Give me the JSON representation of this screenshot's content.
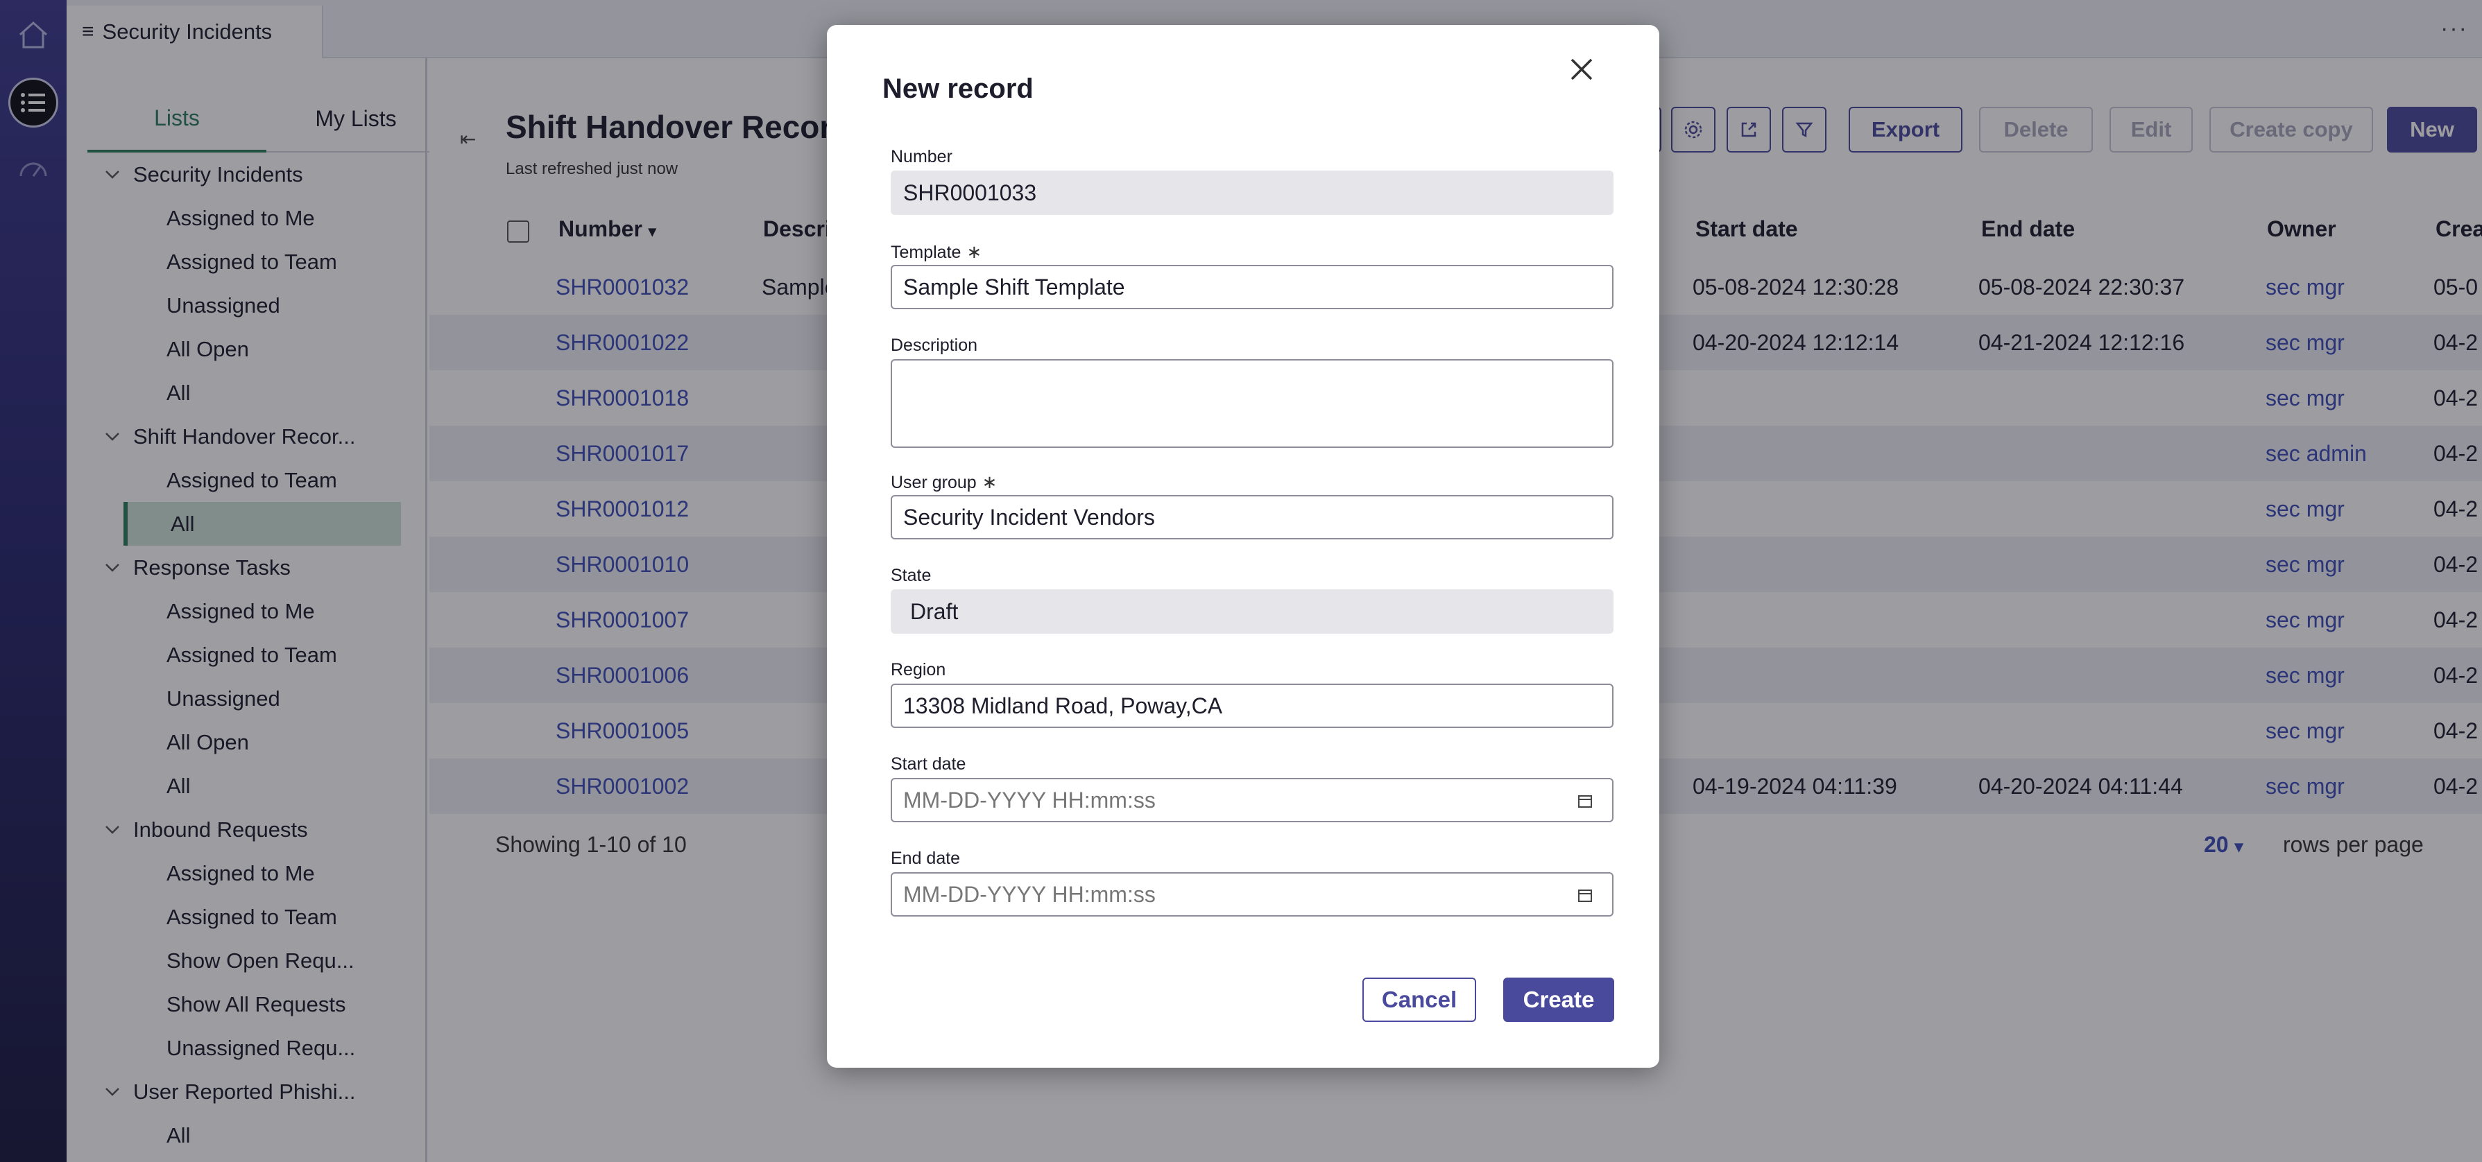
{
  "app": {
    "tab_title": "Security Incidents",
    "more_label": "···"
  },
  "sidenav": {
    "tabs": [
      "Lists",
      "My Lists"
    ],
    "groups": [
      {
        "label": "Security Incidents",
        "items": [
          "Assigned to Me",
          "Assigned to Team",
          "Unassigned",
          "All Open",
          "All"
        ]
      },
      {
        "label": "Shift Handover Recor...",
        "items": [
          "Assigned to Team",
          "All"
        ]
      },
      {
        "label": "Response Tasks",
        "items": [
          "Assigned to Me",
          "Assigned to Team",
          "Unassigned",
          "All Open",
          "All"
        ]
      },
      {
        "label": "Inbound Requests",
        "items": [
          "Assigned to Me",
          "Assigned to Team",
          "Show Open Requ...",
          "Show All Requests",
          "Unassigned Requ..."
        ]
      },
      {
        "label": "User Reported Phishi...",
        "items": [
          "All"
        ]
      }
    ],
    "selected": "Shift Handover Recor... / All"
  },
  "list": {
    "title": "Shift Handover Records",
    "refreshed": "Last refreshed just now",
    "toolbar": {
      "export": "Export",
      "delete": "Delete",
      "edit": "Edit",
      "create_copy": "Create copy",
      "new": "New"
    },
    "columns": {
      "number": "Number",
      "description": "Description",
      "start_date": "Start date",
      "end_date": "End date",
      "owner": "Owner",
      "created": "Created"
    },
    "rows": [
      {
        "number": "SHR0001032",
        "description": "Sample",
        "start": "05-08-2024 12:30:28",
        "end": "05-08-2024 22:30:37",
        "owner": "sec mgr",
        "created": "05-0"
      },
      {
        "number": "SHR0001022",
        "description": "",
        "start": "04-20-2024 12:12:14",
        "end": "04-21-2024 12:12:16",
        "owner": "sec mgr",
        "created": "04-2"
      },
      {
        "number": "SHR0001018",
        "description": "",
        "start": "",
        "end": "",
        "owner": "sec mgr",
        "created": "04-2"
      },
      {
        "number": "SHR0001017",
        "description": "",
        "start": "",
        "end": "",
        "owner": "sec admin",
        "created": "04-2"
      },
      {
        "number": "SHR0001012",
        "description": "",
        "start": "",
        "end": "",
        "owner": "sec mgr",
        "created": "04-2"
      },
      {
        "number": "SHR0001010",
        "description": "",
        "start": "",
        "end": "",
        "owner": "sec mgr",
        "created": "04-2"
      },
      {
        "number": "SHR0001007",
        "description": "",
        "start": "",
        "end": "",
        "owner": "sec mgr",
        "created": "04-2"
      },
      {
        "number": "SHR0001006",
        "description": "",
        "start": "",
        "end": "",
        "owner": "sec mgr",
        "created": "04-2"
      },
      {
        "number": "SHR0001005",
        "description": "",
        "start": "",
        "end": "",
        "owner": "sec mgr",
        "created": "04-2"
      },
      {
        "number": "SHR0001002",
        "description": "",
        "start": "04-19-2024 04:11:39",
        "end": "04-20-2024 04:11:44",
        "owner": "sec mgr",
        "created": "04-2"
      }
    ],
    "footer": {
      "showing": "Showing 1-10 of 10",
      "rows_per_page_value": "20",
      "rows_per_page_label": "rows per page"
    }
  },
  "modal": {
    "title": "New record",
    "fields": {
      "number": {
        "label": "Number",
        "value": "SHR0001033"
      },
      "template": {
        "label": "Template",
        "value": "Sample Shift Template",
        "required": true
      },
      "description": {
        "label": "Description",
        "value": ""
      },
      "user_group": {
        "label": "User group",
        "value": "Security Incident Vendors",
        "required": true
      },
      "state": {
        "label": "State",
        "value": "Draft"
      },
      "region": {
        "label": "Region",
        "value": "13308 Midland Road, Poway,CA"
      },
      "start_date": {
        "label": "Start date",
        "placeholder": "MM-DD-YYYY HH:mm:ss"
      },
      "end_date": {
        "label": "End date",
        "placeholder": "MM-DD-YYYY HH:mm:ss"
      }
    },
    "required_mark": "∗",
    "cancel": "Cancel",
    "create": "Create"
  },
  "colors": {
    "accent": "#4a4a9c",
    "link": "#3d4fb8",
    "nav_selected": "#2e7d5b",
    "rail_top": "#3e3b8c"
  }
}
